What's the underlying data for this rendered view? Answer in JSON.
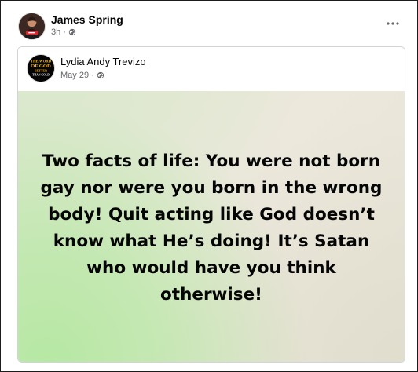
{
  "post": {
    "author_name": "James Spring",
    "time": "3h",
    "dot": "·",
    "privacy_icon": "globe-icon",
    "more_icon": "more-options-icon"
  },
  "shared_post": {
    "author_name": "Lydia Andy Trevizo",
    "time": "May 29",
    "dot": "·",
    "privacy_icon": "globe-icon",
    "avatar_logo_lines": [
      "THE WORD",
      "OF GOD",
      "BETTER",
      "THAN GOLD"
    ],
    "message": "Two facts of life: You were not born gay nor were you born in the wrong body! Quit acting like God doesn’t know what He’s doing! It’s Satan who would have you think otherwise!"
  },
  "colors": {
    "author_text": "#050505",
    "meta_text": "#65676b",
    "card_border": "#d2d4d8",
    "avatar_accent_red": "#d8262f",
    "logo_gold": "#f2b31b",
    "text_background_green": "#b3e8a0"
  }
}
